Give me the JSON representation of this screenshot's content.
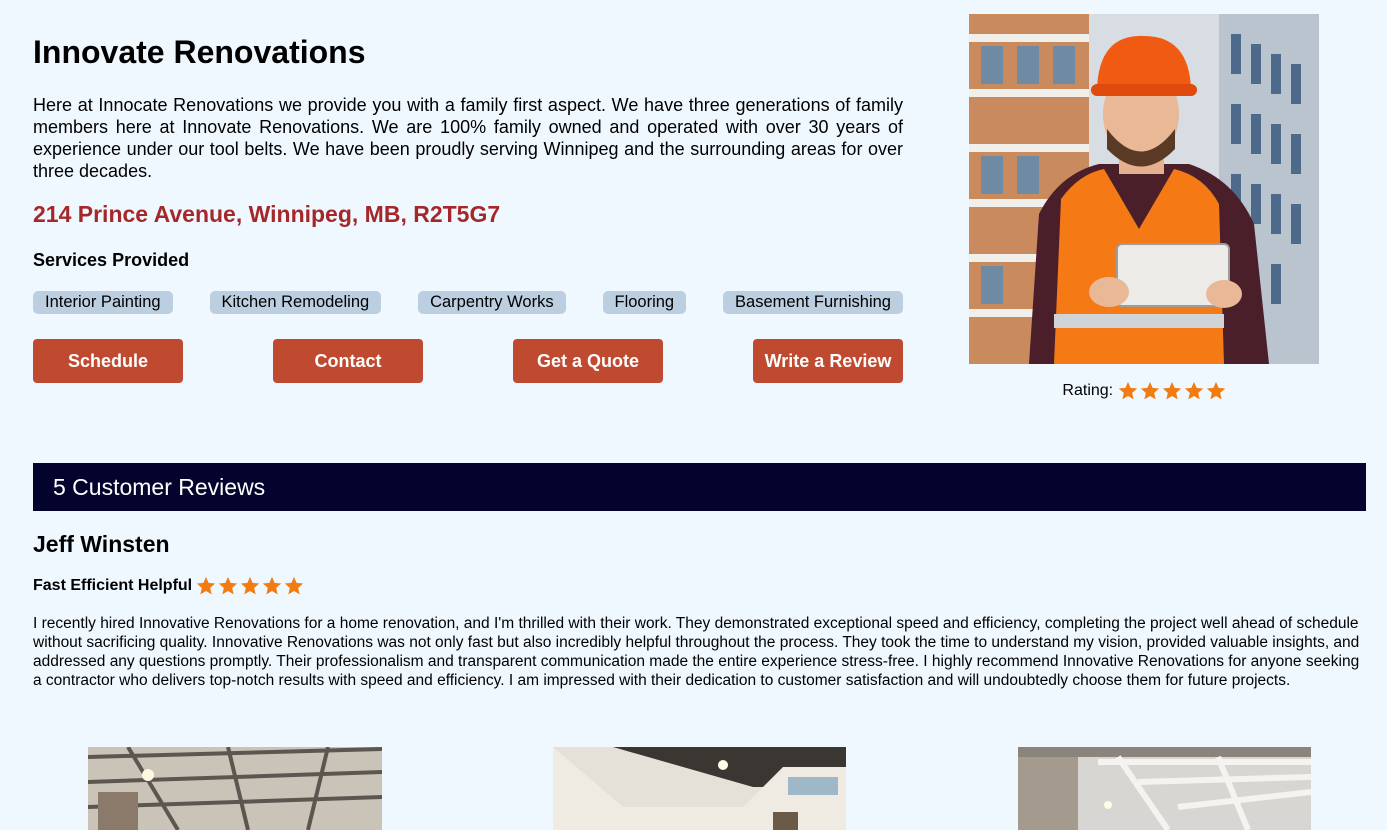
{
  "business": {
    "name": "Innovate Renovations",
    "description": "Here at Innocate Renovations we provide you with a family first aspect. We have three generations of family members here at Innovate Renovations. We are 100% family owned and operated with over 30 years of experience under our tool belts. We have been proudly serving Winnipeg and the surrounding areas for over three decades.",
    "address": "214 Prince Avenue, Winnipeg, MB, R2T5G7"
  },
  "services": {
    "heading": "Services Provided",
    "items": [
      "Interior Painting",
      "Kitchen Remodeling",
      "Carpentry Works",
      "Flooring",
      "Basement Furnishing"
    ]
  },
  "actions": {
    "schedule": "Schedule",
    "contact": "Contact",
    "quote": "Get a Quote",
    "review": "Write a Review"
  },
  "rating": {
    "label": "Rating:",
    "stars": 5,
    "star_color": "#f27b12"
  },
  "reviews": {
    "heading": "5 Customer Reviews",
    "items": [
      {
        "name": "Jeff Winsten",
        "title": "Fast Efficient Helpful",
        "stars": 5,
        "body": "I recently hired Innovative Renovations for a home renovation, and I'm thrilled with their work. They demonstrated exceptional speed and efficiency, completing the project well ahead of schedule without sacrificing quality. Innovative Renovations was not only fast but also incredibly helpful throughout the process. They took the time to understand my vision, provided valuable insights, and addressed any questions promptly. Their professionalism and transparent communication made the entire experience stress-free. I highly recommend Innovative Renovations for anyone seeking a contractor who delivers top-notch results with speed and efficiency. I am impressed with their dedication to customer satisfaction and will undoubtedly choose them for future projects."
      }
    ]
  },
  "colors": {
    "background": "#f0f8ff",
    "accent_button": "#c04a30",
    "address": "#a4282a",
    "tag": "#bccfe0",
    "reviews_bar": "#03032e"
  }
}
